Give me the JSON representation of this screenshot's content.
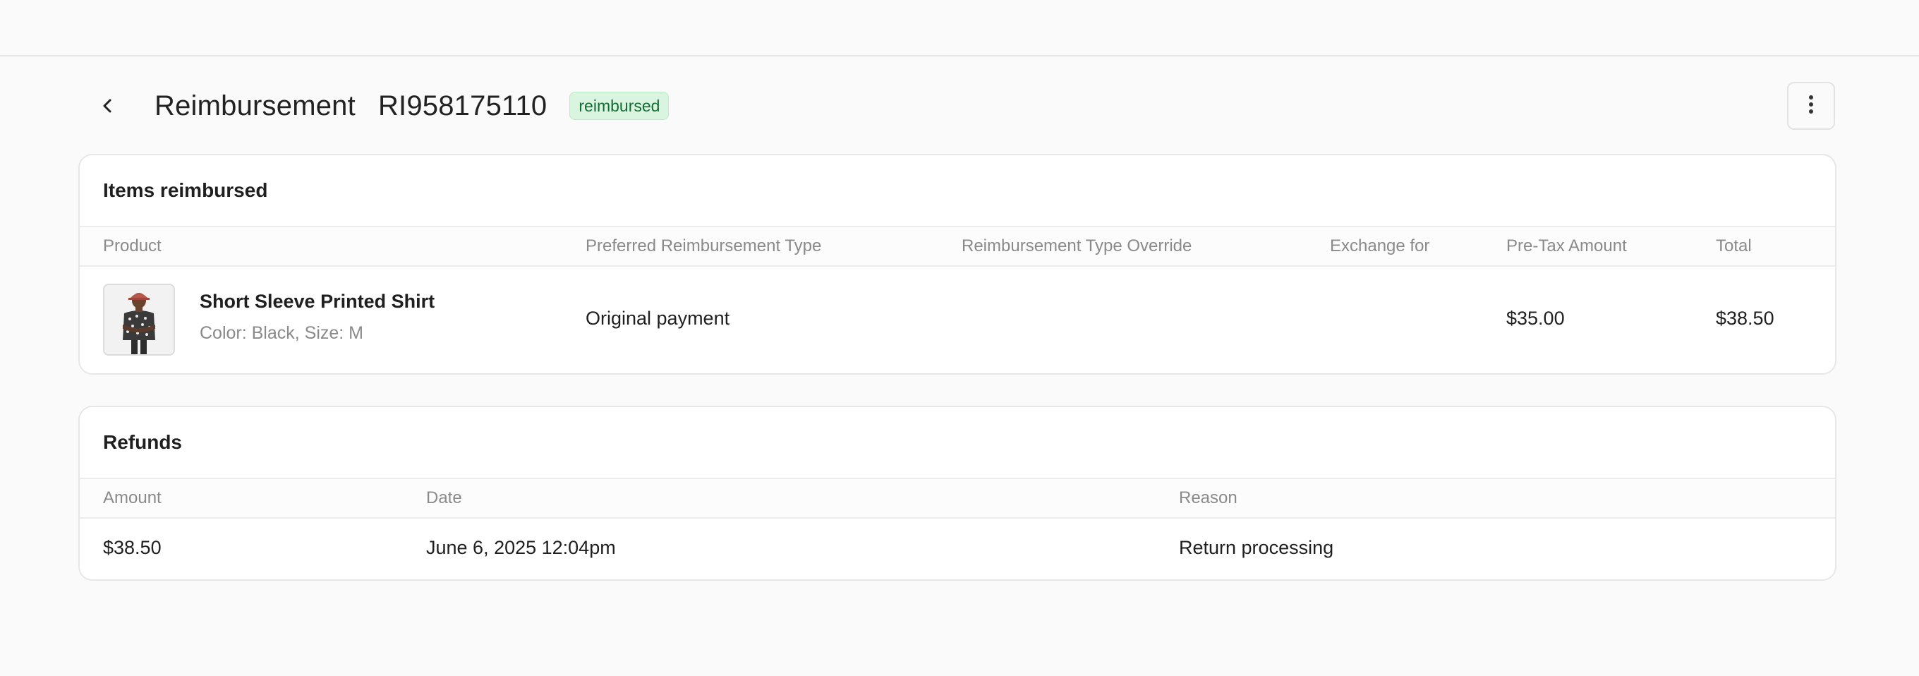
{
  "header": {
    "title": "Reimbursement",
    "id": "RI958175110",
    "status": "reimbursed",
    "back_icon": "chevron-left-icon",
    "more_icon": "more-vertical-icon"
  },
  "items_card": {
    "title": "Items reimbursed",
    "columns": [
      "Product",
      "Preferred Reimbursement Type",
      "Reimbursement Type Override",
      "Exchange for",
      "Pre-Tax Amount",
      "Total"
    ],
    "rows": [
      {
        "product_name": "Short Sleeve Printed Shirt",
        "variant": "Color: Black, Size: M",
        "preferred_type": "Original payment",
        "override": "",
        "exchange_for": "",
        "pre_tax": "$35.00",
        "total": "$38.50"
      }
    ]
  },
  "refunds_card": {
    "title": "Refunds",
    "columns": [
      "Amount",
      "Date",
      "Reason"
    ],
    "rows": [
      {
        "amount": "$38.50",
        "date": "June 6, 2025 12:04pm",
        "reason": "Return processing"
      }
    ]
  },
  "colors": {
    "background": "#fafafa",
    "badge_bg": "#d9f5df",
    "badge_text": "#156c34",
    "muted_text": "#8a8a8a"
  }
}
